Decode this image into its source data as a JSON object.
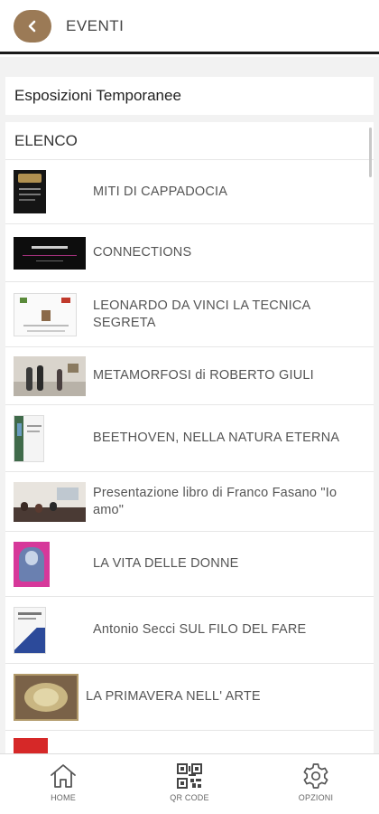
{
  "header": {
    "title": "EVENTI"
  },
  "section": {
    "title": "Esposizioni Temporanee"
  },
  "list": {
    "title": "ELENCO",
    "items": [
      {
        "label": "MITI DI CAPPADOCIA",
        "thumb": "poster-dark"
      },
      {
        "label": "CONNECTIONS",
        "thumb": "banner-dark"
      },
      {
        "label": "LEONARDO DA VINCI LA TECNICA SEGRETA",
        "thumb": "invitation-white"
      },
      {
        "label": "METAMORFOSI di ROBERTO GIULI",
        "thumb": "gallery-photo"
      },
      {
        "label": "BEETHOVEN, NELLA NATURA ETERNA",
        "thumb": "poster-green"
      },
      {
        "label": "Presentazione libro di Franco Fasano \"Io amo\"",
        "thumb": "event-photo"
      },
      {
        "label": "LA VITA DELLE DONNE",
        "thumb": "poster-pink"
      },
      {
        "label": "Antonio Secci SUL FILO DEL FARE",
        "thumb": "poster-blue"
      },
      {
        "label": "LA PRIMAVERA NELL' ARTE",
        "thumb": "painting-flowers"
      }
    ]
  },
  "nav": {
    "home": "HOME",
    "qr": "QR CODE",
    "options": "OPZIONI"
  },
  "colors": {
    "accent": "#9b7a56",
    "divider": "#1a1a1a"
  }
}
